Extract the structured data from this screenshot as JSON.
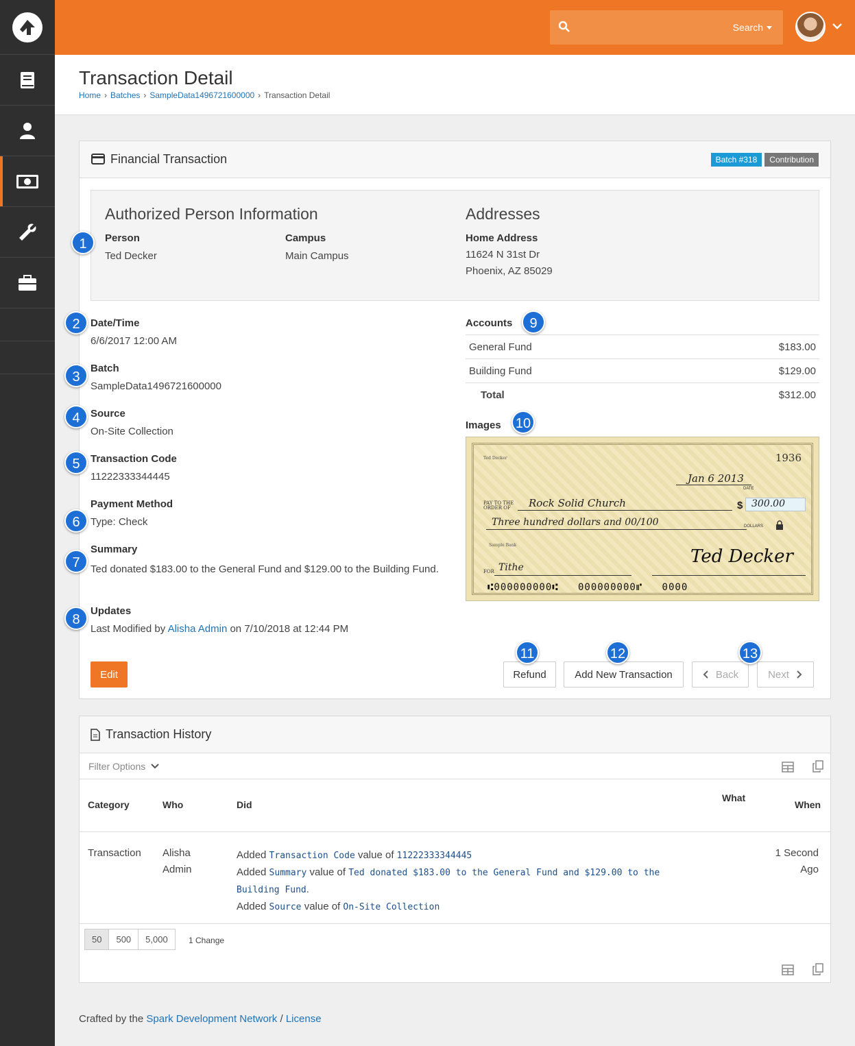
{
  "header": {
    "search_label": "Search"
  },
  "page": {
    "title": "Transaction Detail",
    "breadcrumbs": [
      "Home",
      "Batches",
      "SampleData1496721600000",
      "Transaction Detail"
    ]
  },
  "transaction_panel": {
    "title": "Financial Transaction",
    "batch_badge": "Batch #318",
    "type_badge": "Contribution",
    "auth_heading": "Authorized Person Information",
    "person_label": "Person",
    "person_value": "Ted Decker",
    "campus_label": "Campus",
    "campus_value": "Main Campus",
    "addresses_heading": "Addresses",
    "home_address_label": "Home Address",
    "address_line1": "11624 N 31st Dr",
    "address_line2": "Phoenix, AZ 85029",
    "date_label": "Date/Time",
    "date_value": "6/6/2017 12:00 AM",
    "batch_label": "Batch",
    "batch_value": "SampleData1496721600000",
    "source_label": "Source",
    "source_value": "On-Site Collection",
    "code_label": "Transaction Code",
    "code_value": "11222333344445",
    "payment_label": "Payment Method",
    "payment_value": "Type: Check",
    "summary_label": "Summary",
    "summary_value": "Ted donated $183.00 to the General Fund and $129.00 to the Building Fund.",
    "updates_label": "Updates",
    "updates_prefix": "Last Modified by",
    "updates_person": "Alisha Admin",
    "updates_suffix": "on 7/10/2018 at 12:44 PM",
    "accounts_label": "Accounts",
    "accounts": [
      {
        "name": "General Fund",
        "amount": "$183.00"
      },
      {
        "name": "Building Fund",
        "amount": "$129.00"
      }
    ],
    "total_label": "Total",
    "total_amount": "$312.00",
    "images_label": "Images",
    "buttons": {
      "edit": "Edit",
      "refund": "Refund",
      "add_new": "Add New Transaction",
      "back": "Back",
      "next": "Next"
    }
  },
  "check": {
    "payer": "Ted Decker",
    "number": "1936",
    "date": "Jan 6 2013",
    "date_caption": "DATE",
    "pay_to_caption": "PAY TO THE ORDER OF",
    "payee": "Rock Solid Church",
    "amount": "300.00",
    "written_amount": "Three hundred dollars and 00/100",
    "dollars_caption": "DOLLARS",
    "bank": "Sample Bank",
    "for_caption": "FOR",
    "memo": "Tithe",
    "routing": "⑆000000000⑆",
    "account": "000000000⑈",
    "check_no": "0000",
    "signature": "Ted Decker"
  },
  "annotations": [
    "1",
    "2",
    "3",
    "4",
    "5",
    "6",
    "7",
    "8",
    "9",
    "10",
    "11",
    "12",
    "13"
  ],
  "history_panel": {
    "title": "Transaction History",
    "filter_label": "Filter Options",
    "columns": {
      "category": "Category",
      "who": "Who",
      "did": "Did",
      "what": "What",
      "when": "When"
    },
    "row": {
      "category": "Transaction",
      "who_line1": "Alisha",
      "who_line2": "Admin",
      "when_line1": "1 Second",
      "when_line2": "Ago",
      "did": {
        "added": "Added",
        "value_of": "value of",
        "field1": "Transaction Code",
        "value1": "11222333344445",
        "field2": "Summary",
        "value2a": "Ted donated $183.00 to the General Fund and $129.00 to the",
        "value2b": "Building Fund",
        "field3": "Source",
        "value3": "On-Site Collection"
      }
    },
    "page_sizes": [
      "50",
      "500",
      "5,000"
    ],
    "change_count": "1 Change"
  },
  "footer": {
    "prefix": "Crafted by the",
    "network": "Spark Development Network",
    "sep": "/",
    "license": "License"
  },
  "colors": {
    "brand": "#ee7624",
    "link": "#1f73b7",
    "badge_info": "#1b9ad6",
    "badge_default": "#777777",
    "annotation": "#1d6fd6"
  }
}
